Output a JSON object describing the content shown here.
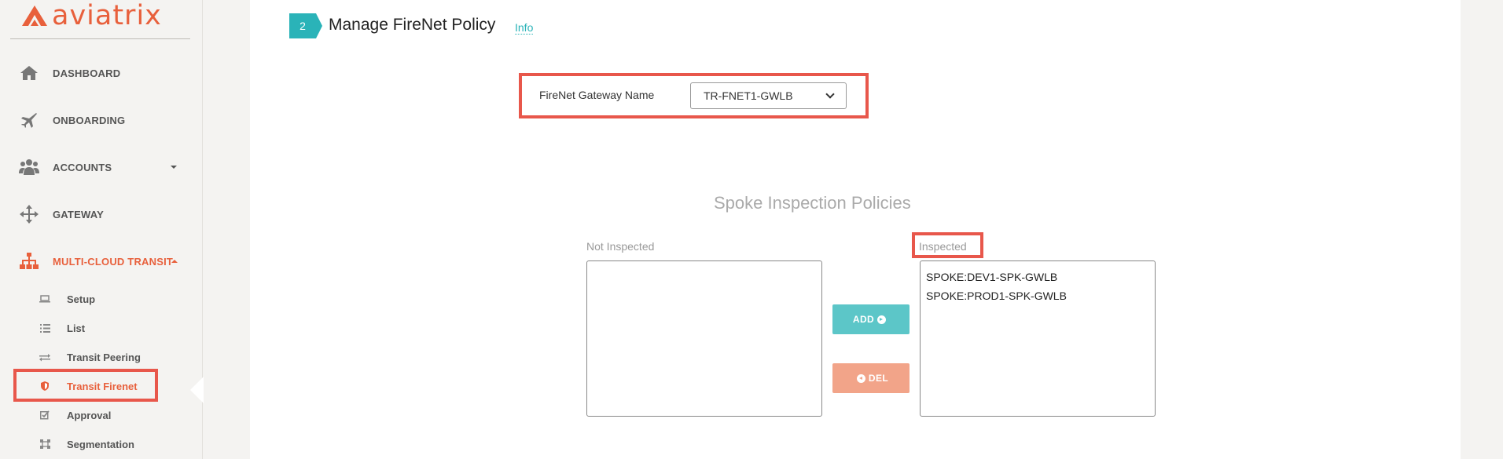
{
  "brand": {
    "name": "aviatrix",
    "color": "#e8603c"
  },
  "sidebar": {
    "items": [
      {
        "label": "DASHBOARD",
        "icon": "home-icon"
      },
      {
        "label": "ONBOARDING",
        "icon": "plane-icon"
      },
      {
        "label": "ACCOUNTS",
        "icon": "users-icon"
      },
      {
        "label": "GATEWAY",
        "icon": "arrows-icon"
      },
      {
        "label": "MULTI-CLOUD TRANSIT",
        "icon": "sitemap-icon",
        "active": true
      }
    ],
    "sub_items": [
      {
        "label": "Setup",
        "icon": "laptop-icon"
      },
      {
        "label": "List",
        "icon": "list-icon"
      },
      {
        "label": "Transit Peering",
        "icon": "exchange-icon"
      },
      {
        "label": "Transit Firenet",
        "icon": "shield-icon",
        "active": true
      },
      {
        "label": "Approval",
        "icon": "checkbox-icon"
      },
      {
        "label": "Segmentation",
        "icon": "segment-icon"
      }
    ]
  },
  "step": {
    "number": "2",
    "title": "Manage FireNet Policy",
    "info": "Info",
    "color": "#2ab3b8"
  },
  "gateway": {
    "label": "FireNet Gateway Name",
    "selected": "TR-FNET1-GWLB"
  },
  "policies": {
    "title": "Spoke Inspection Policies",
    "not_inspected": {
      "label": "Not Inspected",
      "entries": []
    },
    "inspected": {
      "label": "Inspected",
      "entries": [
        "SPOKE:DEV1-SPK-GWLB",
        "SPOKE:PROD1-SPK-GWLB"
      ]
    },
    "add_label": "ADD",
    "del_label": "DEL"
  },
  "colors": {
    "highlight": "#e8574b",
    "add_button": "#5cc6c8",
    "del_button": "#f2a489"
  }
}
